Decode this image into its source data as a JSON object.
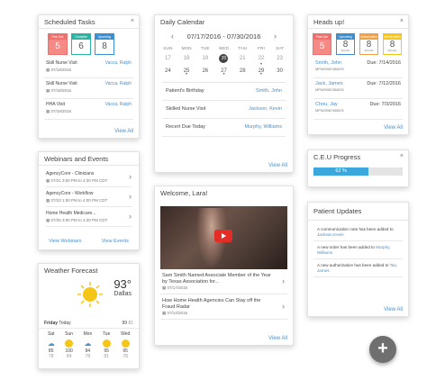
{
  "scheduled_tasks": {
    "title": "Scheduled Tasks",
    "badges": [
      {
        "label": "Past Due",
        "count": "5",
        "color": "#ef6f6c"
      },
      {
        "label": "Complete",
        "count": "6",
        "color": "#2bb3a3"
      },
      {
        "label": "Upcoming",
        "count": "8",
        "color": "#3b8fd0"
      }
    ],
    "tasks": [
      {
        "name": "Skill Nurse Visit",
        "patient": "Vacca, Ralph",
        "date": "07/18/2016"
      },
      {
        "name": "Skill Nurse Visit",
        "patient": "Vacca, Ralph",
        "date": "07/18/2016"
      },
      {
        "name": "HHA Visit",
        "patient": "Vacca, Ralph",
        "date": "07/18/2016"
      }
    ],
    "view_all": "View All"
  },
  "webinars": {
    "title": "Webinars and Events",
    "items": [
      {
        "name": "AgencyCore - Clinicians",
        "time": "07/21 3:00 PM to 4:30 PM CDT"
      },
      {
        "name": "AgencyCore - Workflow",
        "time": "07/23 1:00 PM to 4:00 PM CDT"
      },
      {
        "name": "Home Health Medicare...",
        "time": "07/25 3:00 PM to 4:30 PM CDT"
      }
    ],
    "view_webinars": "View Webinars",
    "view_events": "View Events"
  },
  "weather": {
    "title": "Weather Forecast",
    "temp": "93°",
    "city": "Dallas",
    "today_label": "Friday",
    "today_word": "Today",
    "today_hi": "99",
    "today_lo": "81",
    "days": [
      {
        "day": "Sat",
        "icon": "cloud-rain-icon",
        "hi": "85",
        "lo": "78"
      },
      {
        "day": "Sun",
        "icon": "sun-icon",
        "hi": "100",
        "lo": "84"
      },
      {
        "day": "Mon",
        "icon": "cloud-rain-icon",
        "hi": "84",
        "lo": "78"
      },
      {
        "day": "Tue",
        "icon": "sun-icon",
        "hi": "95",
        "lo": "81"
      },
      {
        "day": "Wed",
        "icon": "sun-icon",
        "hi": "95",
        "lo": "78"
      }
    ]
  },
  "calendar": {
    "title": "Daily Calendar",
    "range": "07/17/2016 - 07/30/2016",
    "weekdays": [
      "SUN",
      "MON",
      "TUE",
      "WED",
      "THU",
      "FRI",
      "SAT"
    ],
    "week1": [
      "17",
      "18",
      "19",
      "20",
      "21",
      "22",
      "23"
    ],
    "week2": [
      "24",
      "25",
      "26",
      "27",
      "28",
      "29",
      "30"
    ],
    "selected": "20",
    "events": [
      {
        "label": "Patient's Birthday",
        "patient": "Smith, John"
      },
      {
        "label": "Skilled Nurse Visit",
        "patient": "Jackson, Kevin"
      },
      {
        "label": "Recert Due Today",
        "patient": "Murphy, Williams"
      }
    ],
    "view_all": "View All"
  },
  "welcome": {
    "title": "Welcome, Lara!",
    "news": [
      {
        "headline": "Sam Smith Named Associate Member of the Year by Texas Association for...",
        "date": "07/17/2016"
      },
      {
        "headline": "How Home Health Agencies Can Stay off the Fraud Radar",
        "date": "07/14/2016"
      }
    ],
    "view_all": "View All"
  },
  "heads_up": {
    "title": "Heads up!",
    "badges": [
      {
        "label": "Past Due",
        "count": "5",
        "color": "#ef6f6c",
        "sub": ""
      },
      {
        "label": "Upcoming",
        "count": "8",
        "color": "#3b8fd0",
        "sub": "Records"
      },
      {
        "label": "Authorization",
        "count": "8",
        "color": "#f0a040",
        "sub": "Records"
      },
      {
        "label": "Authorization",
        "count": "8",
        "color": "#f5c518",
        "sub": "Records"
      }
    ],
    "items": [
      {
        "name": "Smith, John",
        "id": "MPN25987456876",
        "due": "Due: 7/14/2016"
      },
      {
        "name": "Jack, James",
        "id": "MPN25987456876",
        "due": "Due: 7/12/2016"
      },
      {
        "name": "Chou, Jay",
        "id": "MPN25987456876",
        "due": "Due: 7/3/2016"
      }
    ],
    "view_all": "View All"
  },
  "ceu": {
    "title": "C.E.U Progress",
    "progress": 62,
    "progress_label": "62 %"
  },
  "patient_updates": {
    "title": "Patient Updates",
    "items": [
      {
        "text": "A communication note has been added to",
        "patient": "Jackson,Kevin"
      },
      {
        "text": "A new order has been added to",
        "patient": "Murphy, Williams"
      },
      {
        "text": "A new authorization has been added to",
        "patient": "Tao, James"
      }
    ],
    "view_all": "View All"
  },
  "fab": {
    "label": "+"
  },
  "colors": {
    "accent": "#4a90c8",
    "progress": "#3aa8dc"
  }
}
